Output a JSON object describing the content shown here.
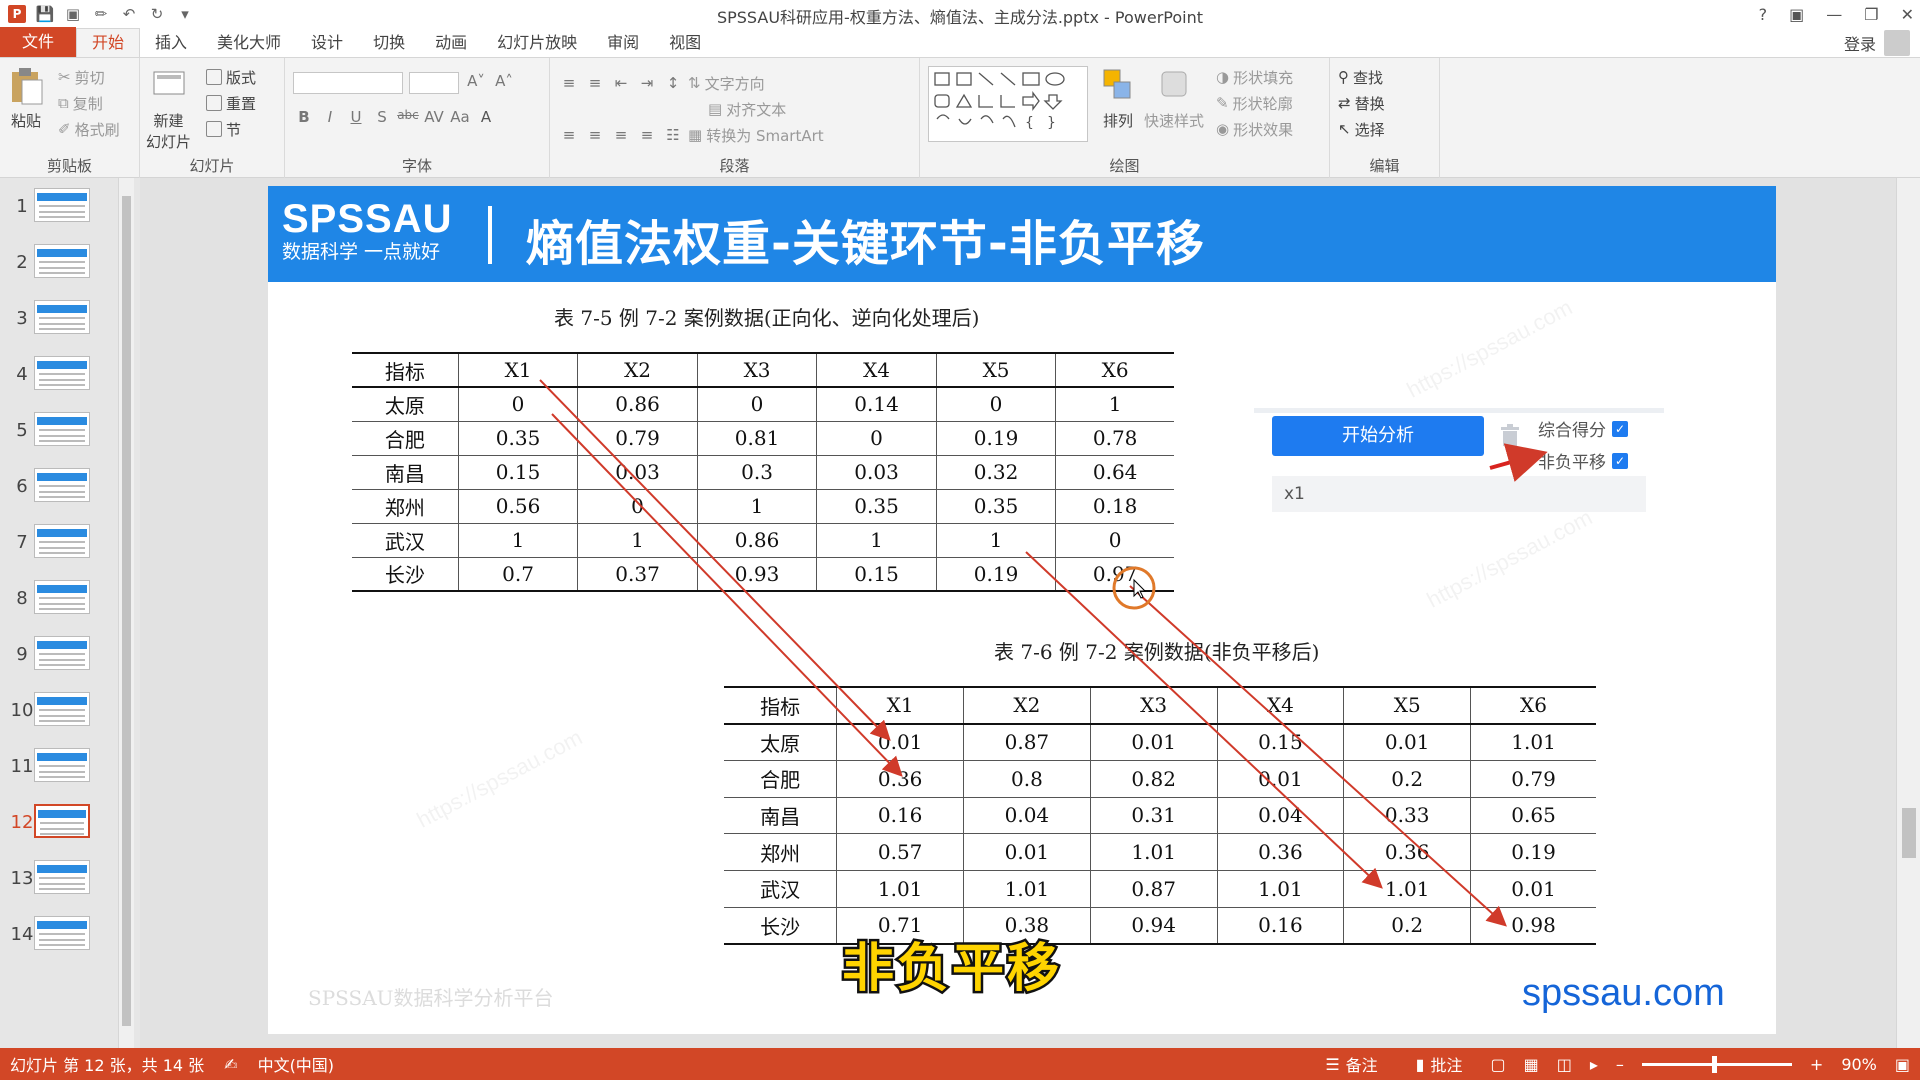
{
  "window": {
    "title": "SPSSAU科研应用-权重方法、熵值法、主成分法.pptx - PowerPoint"
  },
  "tabs": [
    {
      "label": "文件"
    },
    {
      "label": "开始"
    },
    {
      "label": "插入"
    },
    {
      "label": "美化大师"
    },
    {
      "label": "设计"
    },
    {
      "label": "切换"
    },
    {
      "label": "动画"
    },
    {
      "label": "幻灯片放映"
    },
    {
      "label": "审阅"
    },
    {
      "label": "视图"
    }
  ],
  "login": "登录",
  "ribbon": {
    "clipboard": {
      "paste": "粘贴",
      "cut": "剪切",
      "copy": "复制",
      "format_painter": "格式刷",
      "label": "剪贴板"
    },
    "slides": {
      "new_slide": "新建\n幻灯片",
      "layout": "版式",
      "reset": "重置",
      "section": "节",
      "label": "幻灯片"
    },
    "font": {
      "label": "字体"
    },
    "paragraph": {
      "text_direction": "文字方向",
      "align_text": "对齐文本",
      "smartart": "转换为 SmartArt",
      "label": "段落"
    },
    "drawing": {
      "arrange": "排列",
      "quick_styles": "快速样式",
      "shape_fill": "形状填充",
      "shape_outline": "形状轮廓",
      "shape_effects": "形状效果",
      "label": "绘图"
    },
    "editing": {
      "find": "查找",
      "replace": "替换",
      "select": "选择",
      "label": "编辑"
    }
  },
  "thumbnails": {
    "numbers": [
      "1",
      "2",
      "3",
      "4",
      "5",
      "6",
      "7",
      "8",
      "9",
      "10",
      "11",
      "12",
      "13",
      "14"
    ],
    "active": "12"
  },
  "slide": {
    "brand_top": "SPSSAU",
    "brand_bottom": "数据科学 一点就好",
    "title": "熵值法权重-关键环节-非负平移",
    "table1_caption": "表 7-5 例 7-2 案例数据(正向化、逆向化处理后)",
    "table2_caption": "表 7-6 例 7-2 案例数据(非负平移后)",
    "headers": [
      "指标",
      "X1",
      "X2",
      "X3",
      "X4",
      "X5",
      "X6"
    ],
    "table1_rows": [
      [
        "太原",
        "0",
        "0.86",
        "0",
        "0.14",
        "0",
        "1"
      ],
      [
        "合肥",
        "0.35",
        "0.79",
        "0.81",
        "0",
        "0.19",
        "0.78"
      ],
      [
        "南昌",
        "0.15",
        "0.03",
        "0.3",
        "0.03",
        "0.32",
        "0.64"
      ],
      [
        "郑州",
        "0.56",
        "0",
        "1",
        "0.35",
        "0.35",
        "0.18"
      ],
      [
        "武汉",
        "1",
        "1",
        "0.86",
        "1",
        "1",
        "0"
      ],
      [
        "长沙",
        "0.7",
        "0.37",
        "0.93",
        "0.15",
        "0.19",
        "0.97"
      ]
    ],
    "table2_rows": [
      [
        "太原",
        "0.01",
        "0.87",
        "0.01",
        "0.15",
        "0.01",
        "1.01"
      ],
      [
        "合肥",
        "0.36",
        "0.8",
        "0.82",
        "0.01",
        "0.2",
        "0.79"
      ],
      [
        "南昌",
        "0.16",
        "0.04",
        "0.31",
        "0.04",
        "0.33",
        "0.65"
      ],
      [
        "郑州",
        "0.57",
        "0.01",
        "1.01",
        "0.36",
        "0.36",
        "0.19"
      ],
      [
        "武汉",
        "1.01",
        "1.01",
        "0.87",
        "1.01",
        "1.01",
        "0.01"
      ],
      [
        "长沙",
        "0.71",
        "0.38",
        "0.94",
        "0.16",
        "0.2",
        "0.98"
      ]
    ],
    "start_button": "开始分析",
    "checkbox_composite": "综合得分",
    "checkbox_shift": "非负平移",
    "input_value": "x1",
    "footer_watermark": "SPSSAU数据科学分析平台",
    "site": "spssau.com",
    "subtitle": "非负平移",
    "diag_watermark": "https://spssau.com"
  },
  "status": {
    "slide_info": "幻灯片 第 12 张，共 14 张",
    "language": "中文(中国)",
    "notes": "备注",
    "comments": "批注",
    "zoom": "90%"
  },
  "colors": {
    "accent": "#d24726",
    "header_blue": "#1f86e6",
    "button_blue": "#1e7bf0",
    "arrow_red": "#d03a2a",
    "site_blue": "#1565d8"
  }
}
